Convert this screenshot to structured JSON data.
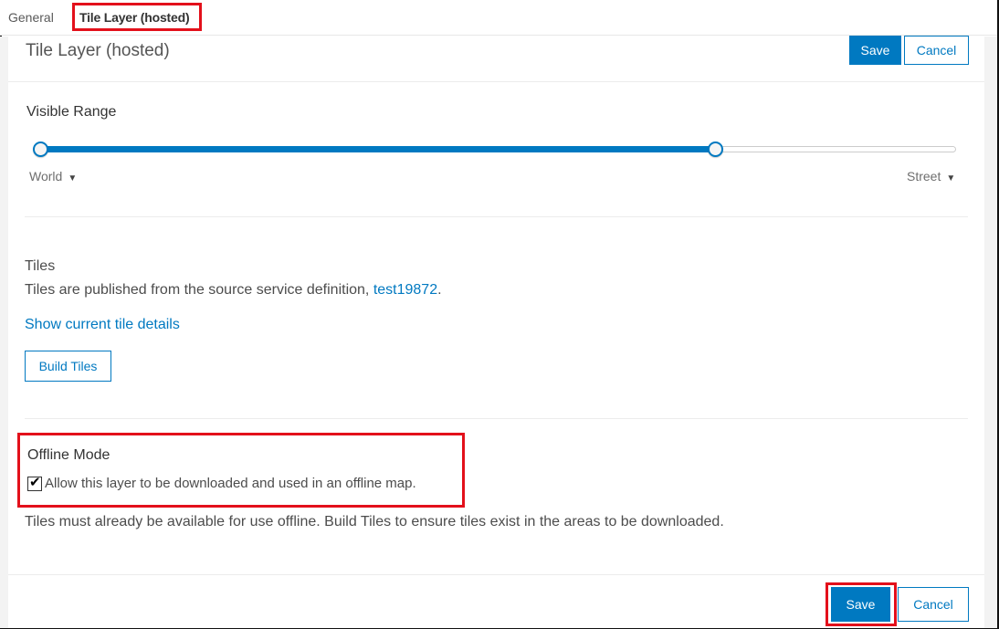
{
  "tabs": [
    {
      "label": "General",
      "active": false
    },
    {
      "label": "Tile Layer (hosted)",
      "active": true
    }
  ],
  "header": {
    "title": "Tile Layer (hosted)",
    "save_label": "Save",
    "cancel_label": "Cancel"
  },
  "visible_range": {
    "label": "Visible Range",
    "min_label": "World",
    "max_label": "Street",
    "min_value_fraction": 0.0,
    "max_value_fraction": 0.74
  },
  "tiles": {
    "label": "Tiles",
    "description_prefix": "Tiles are published from the source service definition, ",
    "source_link": "test19872",
    "description_suffix": ".",
    "show_details_link": "Show current tile details",
    "build_tiles_label": "Build Tiles"
  },
  "offline": {
    "label": "Offline Mode",
    "checkbox_label": "Allow this layer to be downloaded and used in an offline map.",
    "checked": true,
    "note": "Tiles must already be available for use offline. Build Tiles to ensure tiles exist in the areas to be downloaded."
  },
  "footer": {
    "save_label": "Save",
    "cancel_label": "Cancel"
  },
  "colors": {
    "accent": "#0079c1",
    "highlight": "#e3101b"
  }
}
